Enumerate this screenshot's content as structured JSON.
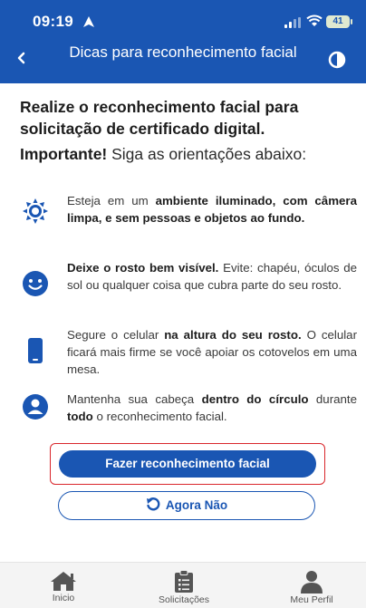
{
  "status": {
    "time": "09:19",
    "battery": "41"
  },
  "header": {
    "title": "Dicas para reconhecimento facial"
  },
  "content": {
    "lead": "Realize o reconhecimento facial para solicitação de certificado digital.",
    "important_label": "Importante!",
    "important_text": " Siga as orientações abaixo:",
    "tips": [
      {
        "icon": "sun-icon",
        "parts": [
          "Esteja em um ",
          "ambiente iluminado, com câmera limpa, e sem pessoas e objetos ao fundo."
        ]
      },
      {
        "icon": "smile-icon",
        "parts": [
          "Deixe o rosto bem visível.",
          " Evite: chapéu, óculos de sol ou qualquer coisa que cubra parte do seu rosto."
        ]
      },
      {
        "icon": "phone-icon",
        "parts": [
          "Segure o celular ",
          "na altura do seu rosto.",
          " O celular ficará mais firme se você apoiar os cotovelos em uma mesa."
        ]
      },
      {
        "icon": "user-circle-icon",
        "parts": [
          "Mantenha sua cabeça ",
          "dentro do círculo",
          " durante ",
          "todo",
          " o reconhecimento facial."
        ]
      }
    ]
  },
  "buttons": {
    "primary": "Fazer reconhecimento facial",
    "secondary": "Agora Não"
  },
  "tabbar": {
    "items": [
      {
        "label": "Inicio",
        "icon": "home-icon"
      },
      {
        "label": "Solicitações",
        "icon": "clipboard-icon"
      },
      {
        "label": "Meu Perfil",
        "icon": "user-icon"
      }
    ]
  },
  "colors": {
    "primary": "#1a56b3",
    "highlight": "#d9262b"
  }
}
